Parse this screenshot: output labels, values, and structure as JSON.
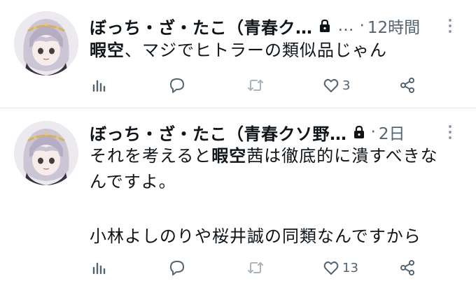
{
  "colors": {
    "text": "#0f1419",
    "secondary": "#536471",
    "divider": "#e6e9ec",
    "icon": "#536471"
  },
  "tweets": [
    {
      "author_name": "ぼっち・ざ・たこ（青春ク…",
      "handle": "…",
      "separator": "·",
      "time": "12時間",
      "text_bold": "暇空",
      "text_rest": "、マジでヒトラーの類似品じゃん",
      "likes": "3",
      "icons": [
        "views-icon",
        "reply-icon",
        "retweet-icon",
        "like-icon",
        "share-icon"
      ]
    },
    {
      "author_name": "ぼっち・ざ・たこ（青春クソ野…",
      "separator": "·",
      "time": "2日",
      "line1_pre": "それを考えると",
      "line1_bold": "暇空",
      "line1_post": "茜は徹底的に潰すべきな",
      "line2": "んですよ。",
      "line3": "小林よしのりや桜井誠の同類なんですから",
      "likes": "13",
      "icons": [
        "views-icon",
        "reply-icon",
        "retweet-icon",
        "like-icon",
        "share-icon"
      ]
    }
  ]
}
